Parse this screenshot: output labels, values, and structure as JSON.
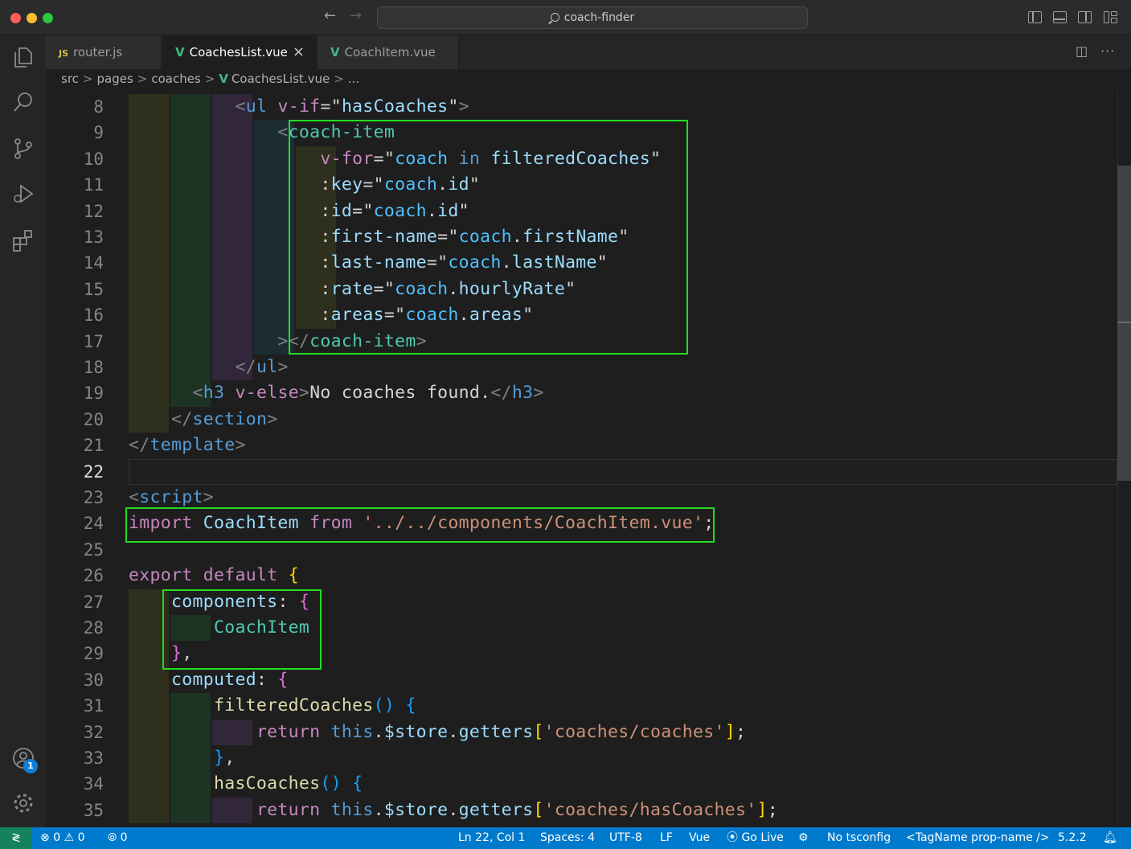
{
  "window": {
    "title": "coach-finder"
  },
  "tabs": [
    {
      "label": "router.js",
      "icon": "js-file-icon",
      "active": false
    },
    {
      "label": "CoachesList.vue",
      "icon": "vue-file-icon",
      "active": true
    },
    {
      "label": "CoachItem.vue",
      "icon": "vue-file-icon",
      "active": false
    }
  ],
  "breadcrumb": {
    "parts": [
      "src",
      "pages",
      "coaches",
      "CoachesList.vue",
      "..."
    ]
  },
  "editor": {
    "line_numbers": [
      "8",
      "9",
      "10",
      "11",
      "12",
      "13",
      "14",
      "15",
      "16",
      "17",
      "18",
      "19",
      "20",
      "21",
      "22",
      "23",
      "24",
      "25",
      "26",
      "27",
      "28",
      "29",
      "30",
      "31",
      "32",
      "33",
      "34",
      "35"
    ],
    "current_line": "22"
  },
  "activity_badge": "1",
  "statusbar": {
    "errors": "0",
    "warnings": "0",
    "ports": "0",
    "position": "Ln 22, Col 1",
    "spaces": "Spaces: 4",
    "encoding": "UTF-8",
    "eol": "LF",
    "language": "Vue",
    "go_live": "Go Live",
    "tsconfig": "No tsconfig",
    "tag_format": "<TagName prop-name />",
    "version": "5.2.2"
  },
  "colors": {
    "status_bar": "#007acc",
    "highlight_box": "#22dd22",
    "editor_bg": "#1e1e1e"
  }
}
